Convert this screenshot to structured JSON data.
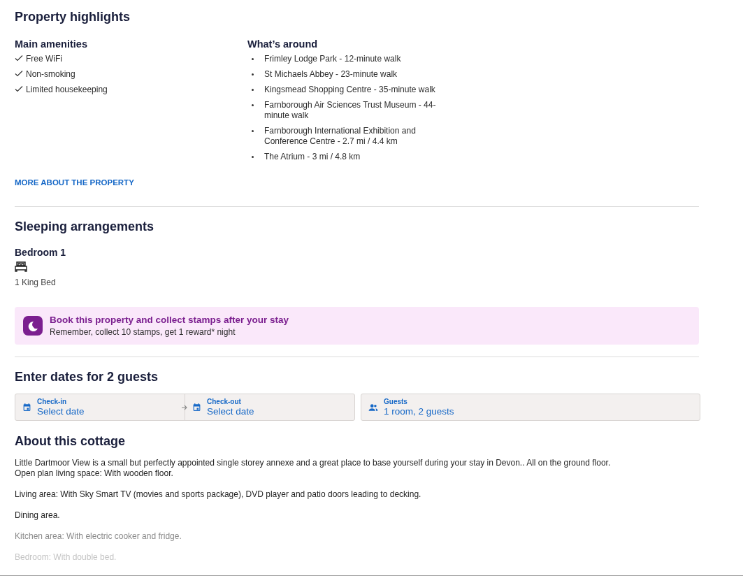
{
  "highlights": {
    "title": "Property highlights",
    "amenities": {
      "title": "Main amenities",
      "items": [
        "Free WiFi",
        "Non-smoking",
        "Limited housekeeping"
      ]
    },
    "around": {
      "title": "What’s around",
      "items": [
        "Frimley Lodge Park - 12-minute walk",
        "St Michaels Abbey - 23-minute walk",
        "Kingsmead Shopping Centre - 35-minute walk",
        "Farnborough Air Sciences Trust Museum - 44-minute walk",
        "Farnborough International Exhibition and Conference Centre - 2.7 mi / 4.4 km",
        "The Atrium - 3 mi / 4.8 km"
      ]
    },
    "link": "MORE ABOUT THE PROPERTY"
  },
  "sleeping": {
    "title": "Sleeping arrangements",
    "rooms": [
      {
        "name": "Bedroom 1",
        "beds": "1 King Bed"
      }
    ]
  },
  "promo": {
    "title": "Book this property and collect stamps after your stay",
    "text": "Remember, collect 10 stamps, get 1 reward* night"
  },
  "dates": {
    "title": "Enter dates for 2 guests",
    "fields": [
      {
        "kind": "date",
        "label": "Check-in",
        "value": "Select date"
      },
      {
        "kind": "date",
        "label": "Check-out",
        "value": "Select date"
      },
      {
        "kind": "guests",
        "label": "Guests",
        "value": "1 room, 2 guests"
      }
    ]
  },
  "about": {
    "title": "About this cottage",
    "paragraphs": [
      {
        "kind": "normal",
        "text": "Little Dartmoor View is a small but perfectly appointed single storey annexe and a great place to base yourself during your stay in Devon.. All on the ground floor.\nOpen plan living space: With wooden floor."
      },
      {
        "kind": "normal",
        "text": "Living area: With Sky Smart TV (movies and sports package), DVD player and patio doors leading to decking."
      },
      {
        "kind": "normal",
        "text": "Dining area."
      },
      {
        "kind": "fading",
        "text": "Kitchen area: With electric cooker and fridge."
      },
      {
        "kind": "faint",
        "text": "Bedroom: With double bed."
      }
    ]
  }
}
